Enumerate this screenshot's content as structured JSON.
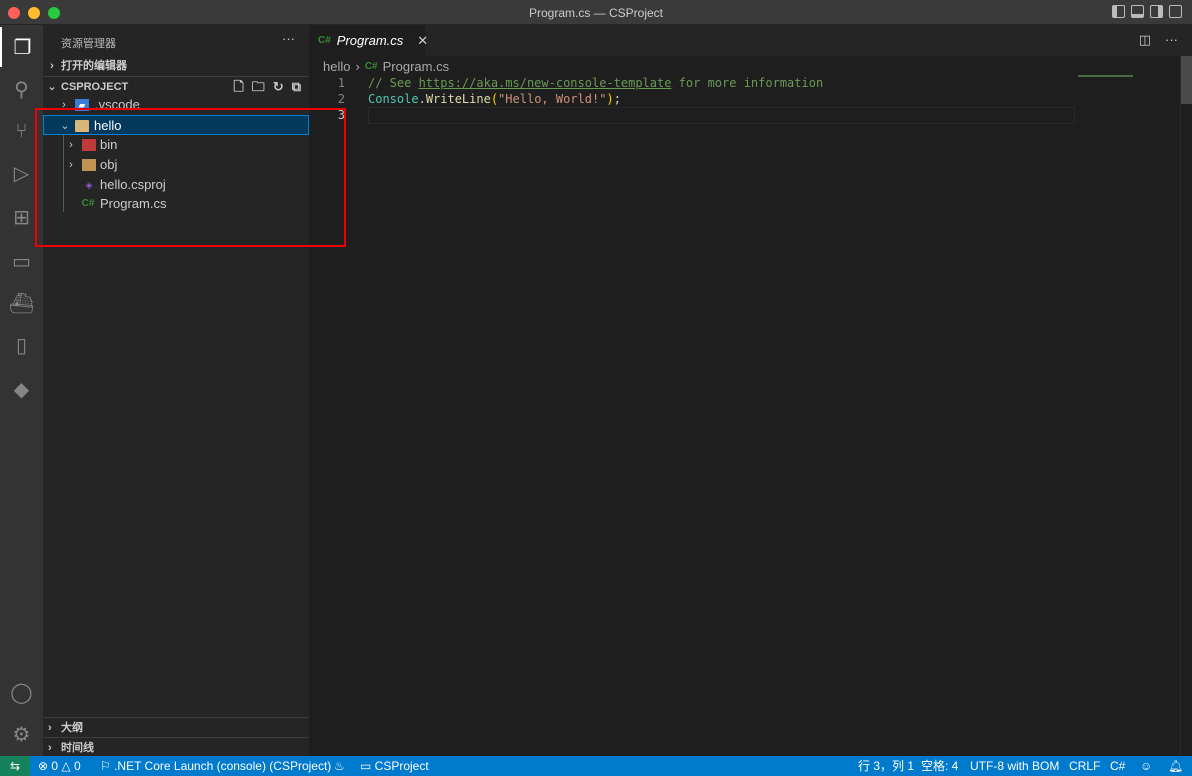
{
  "window": {
    "title": "Program.cs — CSProject"
  },
  "sidebar": {
    "title": "资源管理器",
    "open_editors": "打开的编辑器",
    "project": "CSPROJECT",
    "tree": [
      {
        "label": ".vscode",
        "type": "folder"
      },
      {
        "label": "hello",
        "type": "folder",
        "expanded": true,
        "selected": true
      },
      {
        "label": "bin",
        "type": "folder"
      },
      {
        "label": "obj",
        "type": "folder"
      },
      {
        "label": "hello.csproj",
        "type": "file"
      },
      {
        "label": "Program.cs",
        "type": "file"
      }
    ],
    "outline": "大纲",
    "timeline": "时间线"
  },
  "editor": {
    "tab_label": "Program.cs",
    "tab_lang": "C#",
    "breadcrumb": [
      "hello",
      "Program.cs"
    ],
    "line_numbers": [
      "1",
      "2",
      "3"
    ],
    "code": {
      "comment_prefix": "// See ",
      "link": "https://aka.ms/new-console-template",
      "comment_suffix": " for more information",
      "cls": "Console",
      "dot": ".",
      "method": "WriteLine",
      "open": "(",
      "str": "\"Hello, World!\"",
      "close": ")",
      "semi": ";"
    }
  },
  "status": {
    "errors": "0",
    "warnings": "0",
    "launch": ".NET Core Launch (console) (CSProject)",
    "project": "CSProject",
    "position": "行 3，列 1",
    "spaces": "空格: 4",
    "encoding": "UTF-8 with BOM",
    "eol": "CRLF",
    "language": "C#"
  },
  "colors": {
    "accent": "#007acc",
    "selection": "#04395e",
    "highlight_box": "#ee0000"
  }
}
